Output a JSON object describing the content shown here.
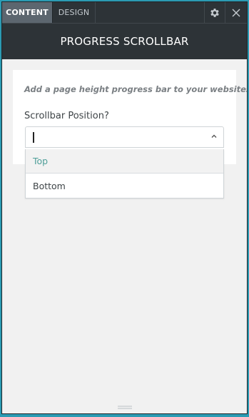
{
  "tabs": [
    {
      "label": "CONTENT",
      "active": true
    },
    {
      "label": "DESIGN",
      "active": false
    }
  ],
  "toolbar": {
    "settings_icon": "gear-icon",
    "close_icon": "close-icon"
  },
  "header": {
    "title": "PROGRESS SCROLLBAR"
  },
  "content": {
    "description": "Add a page height progress bar to your websites.",
    "field_label": "Scrollbar Position?",
    "select_value": "",
    "options": [
      {
        "label": "Top",
        "highlighted": true
      },
      {
        "label": "Bottom",
        "highlighted": false
      }
    ]
  },
  "colors": {
    "background": "#2b9bb3",
    "header": "#2d3337",
    "active_tab": "#5c666f",
    "option_highlight": "#4f9f99"
  }
}
